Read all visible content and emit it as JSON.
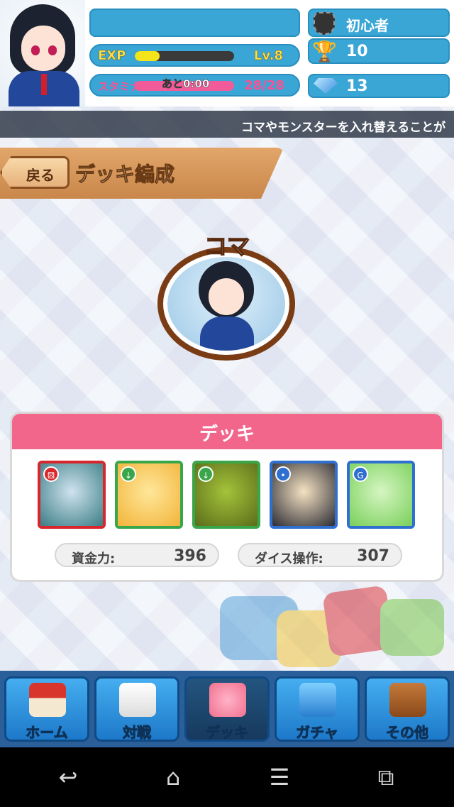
{
  "header": {
    "exp_label": "EXP",
    "exp_progress": 0.25,
    "level": "Lv.8",
    "stamina_label": "スタミナ",
    "stamina_timer": "あと0:00",
    "stamina_value": "28/28",
    "stamina_progress": 1.0,
    "rank": "初心者",
    "trophies": "10",
    "gems": "13"
  },
  "ticker": {
    "text": "コマやモンスターを入れ替えることが"
  },
  "title_bar": {
    "back_label": "戻る",
    "title": "デッキ編成"
  },
  "koma": {
    "label": "コマ"
  },
  "deck": {
    "title": "デッキ",
    "cards": [
      {
        "frame": "red",
        "badge": "dice",
        "colors": [
          "#cfe3ee",
          "#3b7d86"
        ]
      },
      {
        "frame": "green",
        "badge": "down",
        "colors": [
          "#ffe79a",
          "#f2b43a"
        ]
      },
      {
        "frame": "green",
        "badge": "down",
        "colors": [
          "#a4c33a",
          "#5a6d1a"
        ]
      },
      {
        "frame": "blue",
        "badge": "foot",
        "colors": [
          "#f5e2c2",
          "#2c2c34"
        ]
      },
      {
        "frame": "blue",
        "badge": "g",
        "colors": [
          "#d6f5c2",
          "#78d05a"
        ]
      }
    ],
    "stats": [
      {
        "label": "資金力:",
        "value": "396"
      },
      {
        "label": "ダイス操作:",
        "value": "307"
      }
    ]
  },
  "nav": {
    "items": [
      {
        "label": "ホーム",
        "icon": "house-icon",
        "active": false
      },
      {
        "label": "対戦",
        "icon": "dice-icon",
        "active": false
      },
      {
        "label": "デッキ",
        "icon": "monster-icon",
        "active": true
      },
      {
        "label": "ガチャ",
        "icon": "gem-box-icon",
        "active": false
      },
      {
        "label": "その他",
        "icon": "signpost-icon",
        "active": false
      }
    ]
  },
  "system_nav": {
    "back": "back-icon",
    "home": "home-icon",
    "menu": "menu-icon",
    "recents": "recents-icon"
  },
  "colors": {
    "accent_blue": "#3aa6d6",
    "deck_pink": "#f2668c",
    "title_brown": "#c9874a"
  }
}
